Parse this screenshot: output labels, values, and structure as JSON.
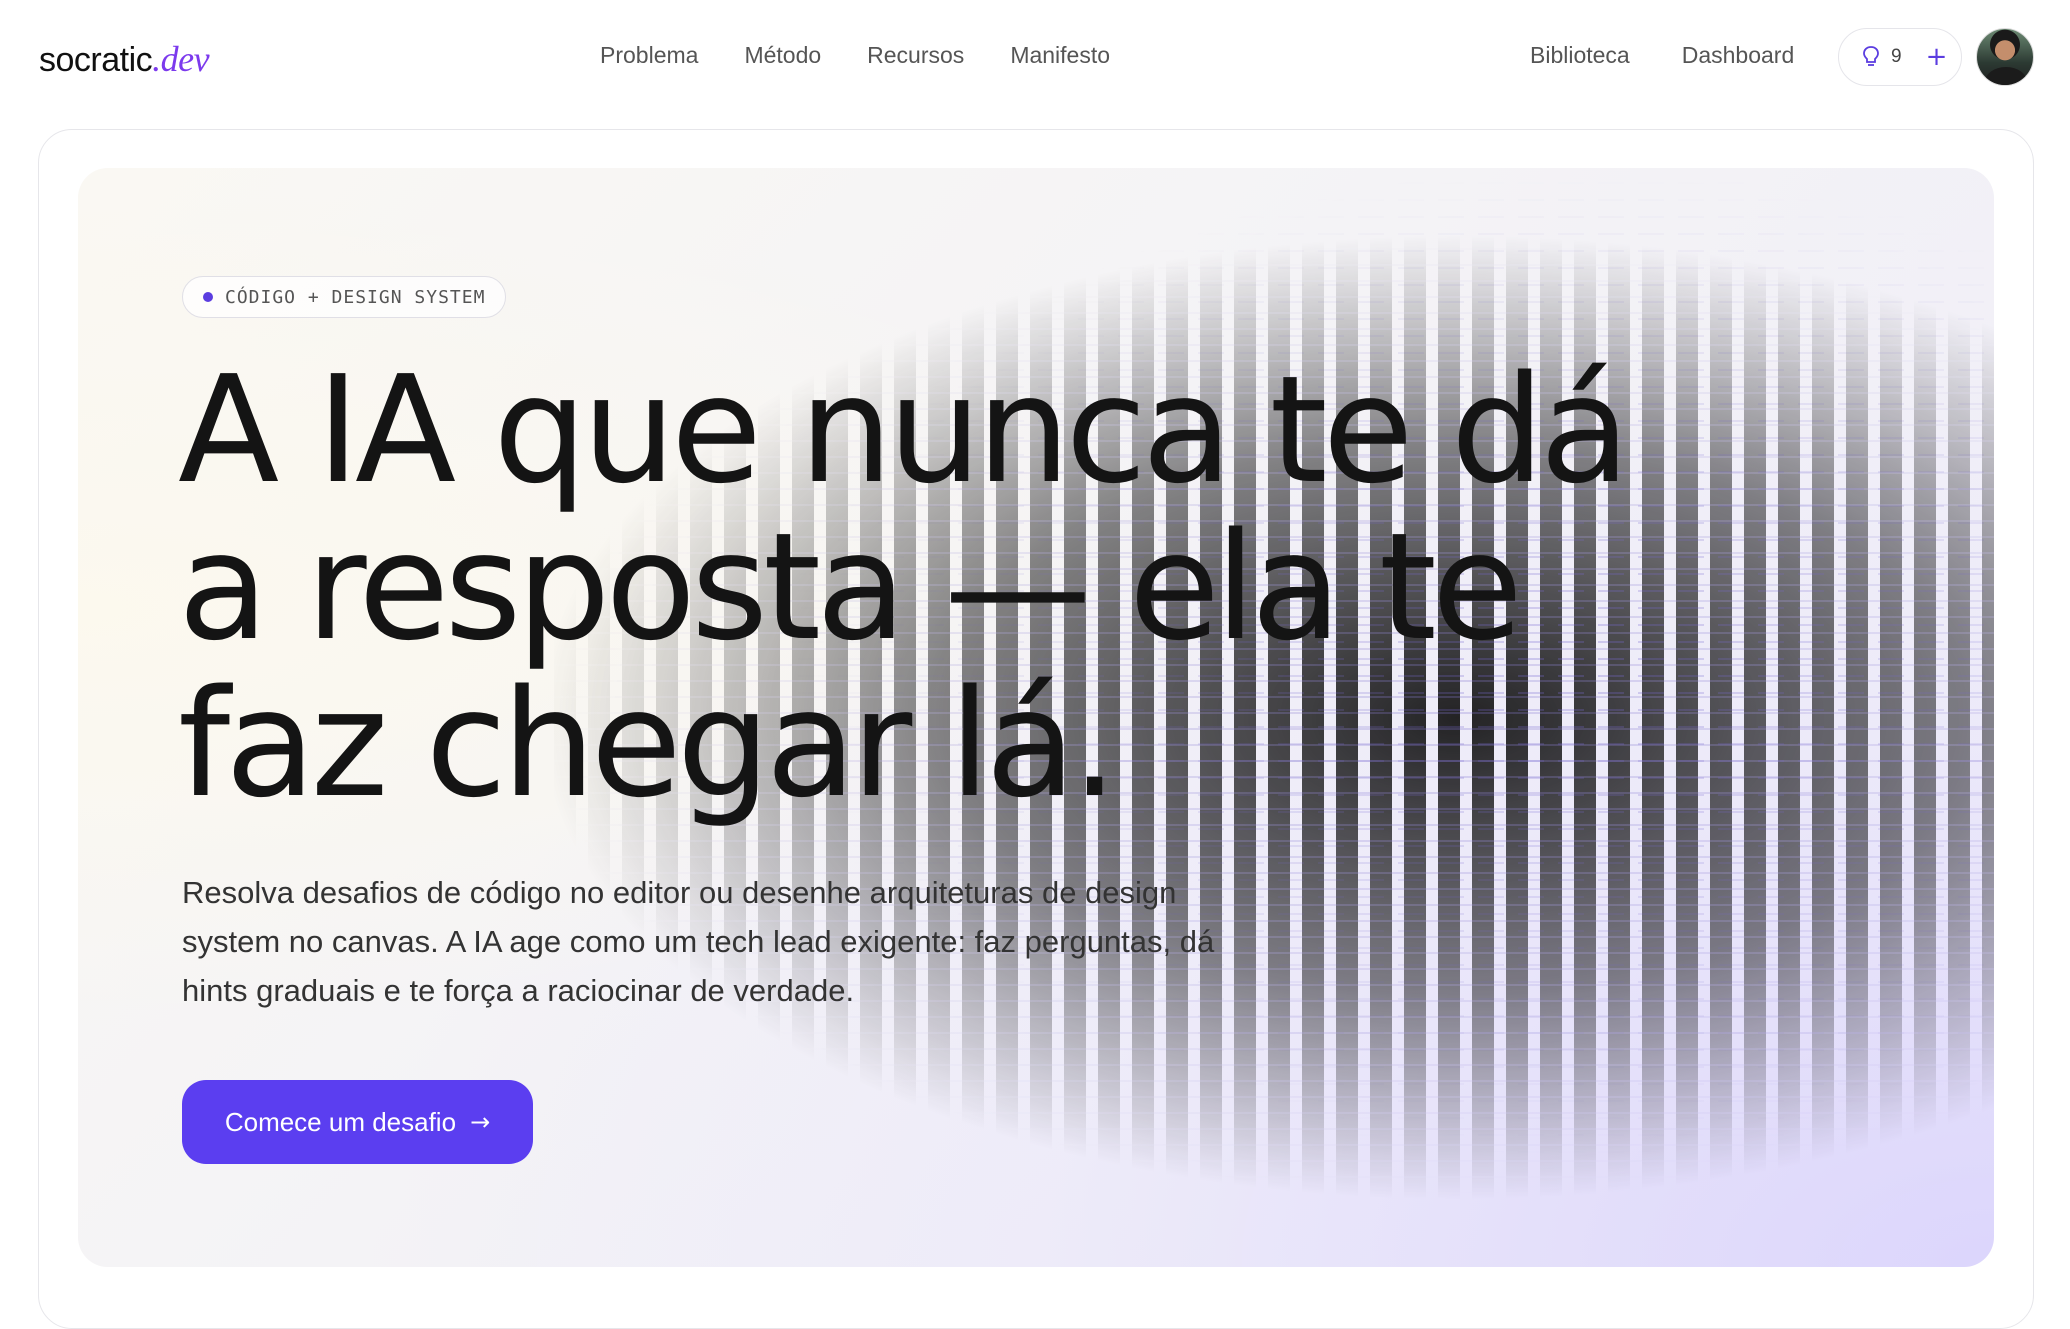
{
  "logo": {
    "main": "socratic",
    "accent": ".dev"
  },
  "nav": {
    "center": [
      "Problema",
      "Método",
      "Recursos",
      "Manifesto"
    ],
    "right": [
      "Biblioteca",
      "Dashboard"
    ],
    "hints": {
      "count": "9",
      "icon": "lightbulb-icon",
      "add_icon": "plus-icon"
    },
    "avatar_icon": "user-avatar"
  },
  "hero": {
    "badge": "CÓDIGO + DESIGN SYSTEM",
    "headline": [
      "A IA que nunca te dá",
      "a resposta — ela te",
      "faz chegar lá."
    ],
    "subtitle": "Resolva desafios de código no editor ou desenhe arquiteturas de design system no canvas. A IA age como um tech lead exigente: faz perguntas, dá hints graduais e te força a raciocinar de verdade.",
    "cta": {
      "label": "Comece um desafio",
      "icon": "arrow-right-icon"
    }
  },
  "colors": {
    "accent": "#5b3ef0",
    "logo_accent": "#7c3aed",
    "text": "#141414",
    "muted": "#555555"
  }
}
